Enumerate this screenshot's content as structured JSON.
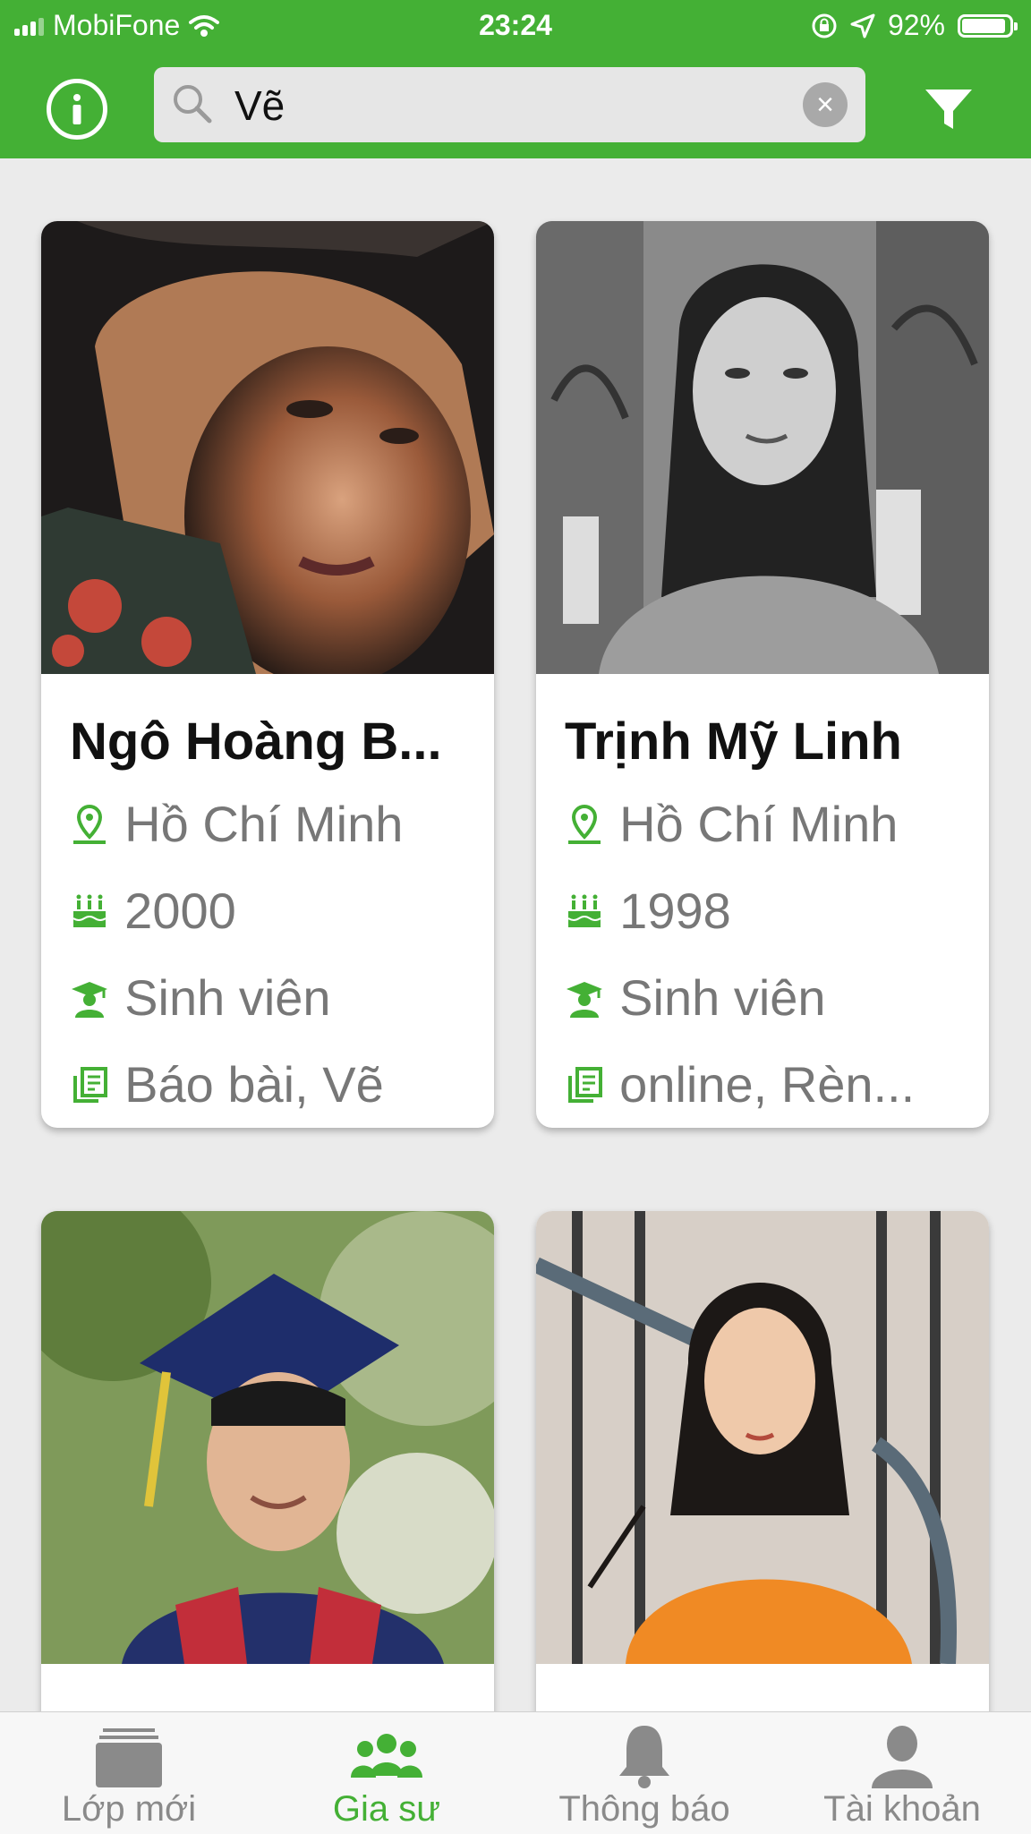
{
  "status_bar": {
    "carrier": "MobiFone",
    "time": "23:24",
    "battery": "92%",
    "battery_level": 0.92
  },
  "search": {
    "value": "Vẽ",
    "placeholder": ""
  },
  "accent_color": "#44b035",
  "tutors": [
    {
      "name": "Ngô Hoàng B...",
      "location": "Hồ Chí Minh",
      "birth_year": "2000",
      "occupation": "Sinh viên",
      "subjects": "Báo bài, Vẽ",
      "photo": "portrait-woman-warm-light"
    },
    {
      "name": "Trịnh Mỹ Linh",
      "location": "Hồ Chí Minh",
      "birth_year": "1998",
      "occupation": "Sinh viên",
      "subjects": "online, Rèn...",
      "photo": "portrait-woman-grayscale"
    },
    {
      "photo": "portrait-man-graduation"
    },
    {
      "photo": "portrait-woman-orange-shirt"
    }
  ],
  "icons": {
    "info": "info-circle-icon",
    "search": "search-icon",
    "clear": "clear-icon",
    "filter": "filter-icon",
    "location": "location-pin-icon",
    "birth": "cake-icon",
    "occupation": "graduate-icon",
    "subjects": "book-icon"
  },
  "tabs": [
    {
      "label": "Lớp mới",
      "icon": "classes-icon",
      "active": false
    },
    {
      "label": "Gia sư",
      "icon": "tutors-icon",
      "active": true
    },
    {
      "label": "Thông báo",
      "icon": "bell-icon",
      "active": false
    },
    {
      "label": "Tài khoản",
      "icon": "account-icon",
      "active": false
    }
  ]
}
